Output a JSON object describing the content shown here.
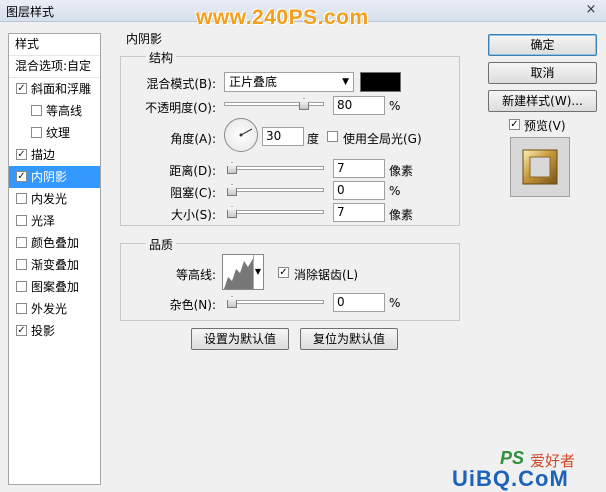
{
  "window": {
    "title": "图层样式",
    "close_glyph": "×"
  },
  "watermark": {
    "text": "www.240PS.com"
  },
  "style_list": {
    "header": "样式",
    "blend_options": "混合选项:自定",
    "items": [
      {
        "label": "斜面和浮雕",
        "checked": true,
        "sub": false,
        "selected": false
      },
      {
        "label": "等高线",
        "checked": false,
        "sub": true,
        "selected": false
      },
      {
        "label": "纹理",
        "checked": false,
        "sub": true,
        "selected": false
      },
      {
        "label": "描边",
        "checked": true,
        "sub": false,
        "selected": false
      },
      {
        "label": "内阴影",
        "checked": true,
        "sub": false,
        "selected": true
      },
      {
        "label": "内发光",
        "checked": false,
        "sub": false,
        "selected": false
      },
      {
        "label": "光泽",
        "checked": false,
        "sub": false,
        "selected": false
      },
      {
        "label": "颜色叠加",
        "checked": false,
        "sub": false,
        "selected": false
      },
      {
        "label": "渐变叠加",
        "checked": false,
        "sub": false,
        "selected": false
      },
      {
        "label": "图案叠加",
        "checked": false,
        "sub": false,
        "selected": false
      },
      {
        "label": "外发光",
        "checked": false,
        "sub": false,
        "selected": false
      },
      {
        "label": "投影",
        "checked": true,
        "sub": false,
        "selected": false
      }
    ]
  },
  "panel": {
    "title": "内阴影",
    "structure": {
      "title": "结构",
      "blend_mode_label": "混合模式(B):",
      "blend_mode_value": "正片叠底",
      "blend_color": "#000000",
      "opacity_label": "不透明度(O):",
      "opacity_value": "80",
      "opacity_fraction": 0.8,
      "opacity_unit": "%",
      "angle_label": "角度(A):",
      "angle_value": "30",
      "angle_unit": "度",
      "global_light_label": "使用全局光(G)",
      "global_light_checked": false,
      "distance_label": "距离(D):",
      "distance_value": "7",
      "distance_fraction": 0.03,
      "distance_unit": "像素",
      "choke_label": "阻塞(C):",
      "choke_value": "0",
      "choke_fraction": 0.0,
      "choke_unit": "%",
      "size_label": "大小(S):",
      "size_value": "7",
      "size_fraction": 0.03,
      "size_unit": "像素"
    },
    "quality": {
      "title": "品质",
      "contour_label": "等高线:",
      "anti_alias_label": "消除锯齿(L)",
      "anti_alias_checked": true,
      "noise_label": "杂色(N):",
      "noise_value": "0",
      "noise_fraction": 0.0,
      "noise_unit": "%"
    },
    "make_default": "设置为默认值",
    "reset_default": "复位为默认值"
  },
  "actions": {
    "ok": "确定",
    "cancel": "取消",
    "new_style": "新建样式(W)...",
    "preview_label": "预览(V)",
    "preview_checked": true
  },
  "branding": {
    "ps_logo": "PS",
    "ps_text": "爱好者",
    "site_text": "UiBQ.CoM"
  }
}
